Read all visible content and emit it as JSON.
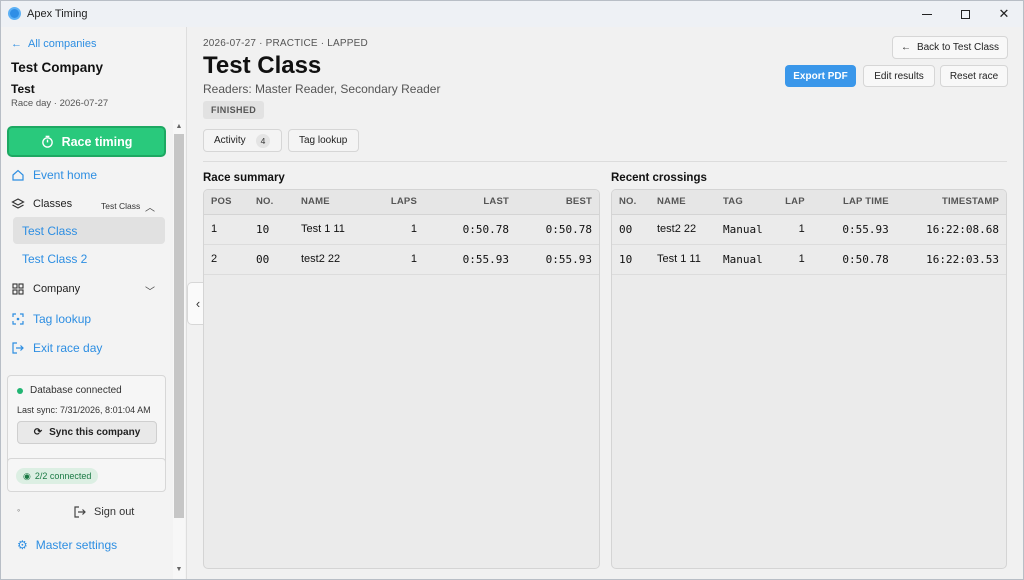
{
  "window": {
    "title": "Apex Timing"
  },
  "sidebar": {
    "back_label": "All companies",
    "company_name": "Test Company",
    "event_name": "Test",
    "event_date": "Race day · 2026-07-27",
    "race_timing_label": "Race timing",
    "event_home_label": "Event home",
    "classes_label": "Classes",
    "classes_badge": "Test Class",
    "class_items": [
      "Test Class",
      "Test Class 2"
    ],
    "company_label": "Company",
    "tag_lookup_label": "Tag lookup",
    "exit_label": "Exit race day",
    "db_status": "Database connected",
    "last_sync": "Last sync: 7/31/2026, 8:01:04 AM",
    "sync_label": "Sync this company",
    "connected": "2/2 connected",
    "signout_label": "Sign out",
    "master_settings_label": "Master settings",
    "status_color": "#22b573",
    "accent_color": "#2d8ee2",
    "race_timing_color": "#29c97c"
  },
  "main": {
    "meta": "2026-07-27 · PRACTICE · LAPPED",
    "title": "Test Class",
    "readers": "Readers: Master Reader, Secondary Reader",
    "status": "FINISHED",
    "back_button": "Back to Test Class",
    "export_button": "Export PDF",
    "edit_button": "Edit results",
    "reset_button": "Reset race",
    "tabs": [
      {
        "label": "Activity",
        "count": "4"
      },
      {
        "label": "Tag lookup"
      }
    ],
    "race_summary": {
      "title": "Race summary",
      "headers": [
        "POS",
        "NO.",
        "NAME",
        "LAPS",
        "LAST",
        "BEST"
      ],
      "rows": [
        {
          "pos": "1",
          "no": "10",
          "name": "Test 1 11",
          "laps": "1",
          "last": "0:50.78",
          "best": "0:50.78"
        },
        {
          "pos": "2",
          "no": "00",
          "name": "test2 22",
          "laps": "1",
          "last": "0:55.93",
          "best": "0:55.93"
        }
      ]
    },
    "recent_crossings": {
      "title": "Recent crossings",
      "headers": [
        "NO.",
        "NAME",
        "TAG",
        "LAP",
        "LAP TIME",
        "TIMESTAMP"
      ],
      "rows": [
        {
          "no": "00",
          "name": "test2 22",
          "tag": "Manual",
          "lap": "1",
          "lap_time": "0:55.93",
          "timestamp": "16:22:08.68"
        },
        {
          "no": "10",
          "name": "Test 1 11",
          "tag": "Manual",
          "lap": "1",
          "lap_time": "0:50.78",
          "timestamp": "16:22:03.53"
        }
      ]
    }
  }
}
